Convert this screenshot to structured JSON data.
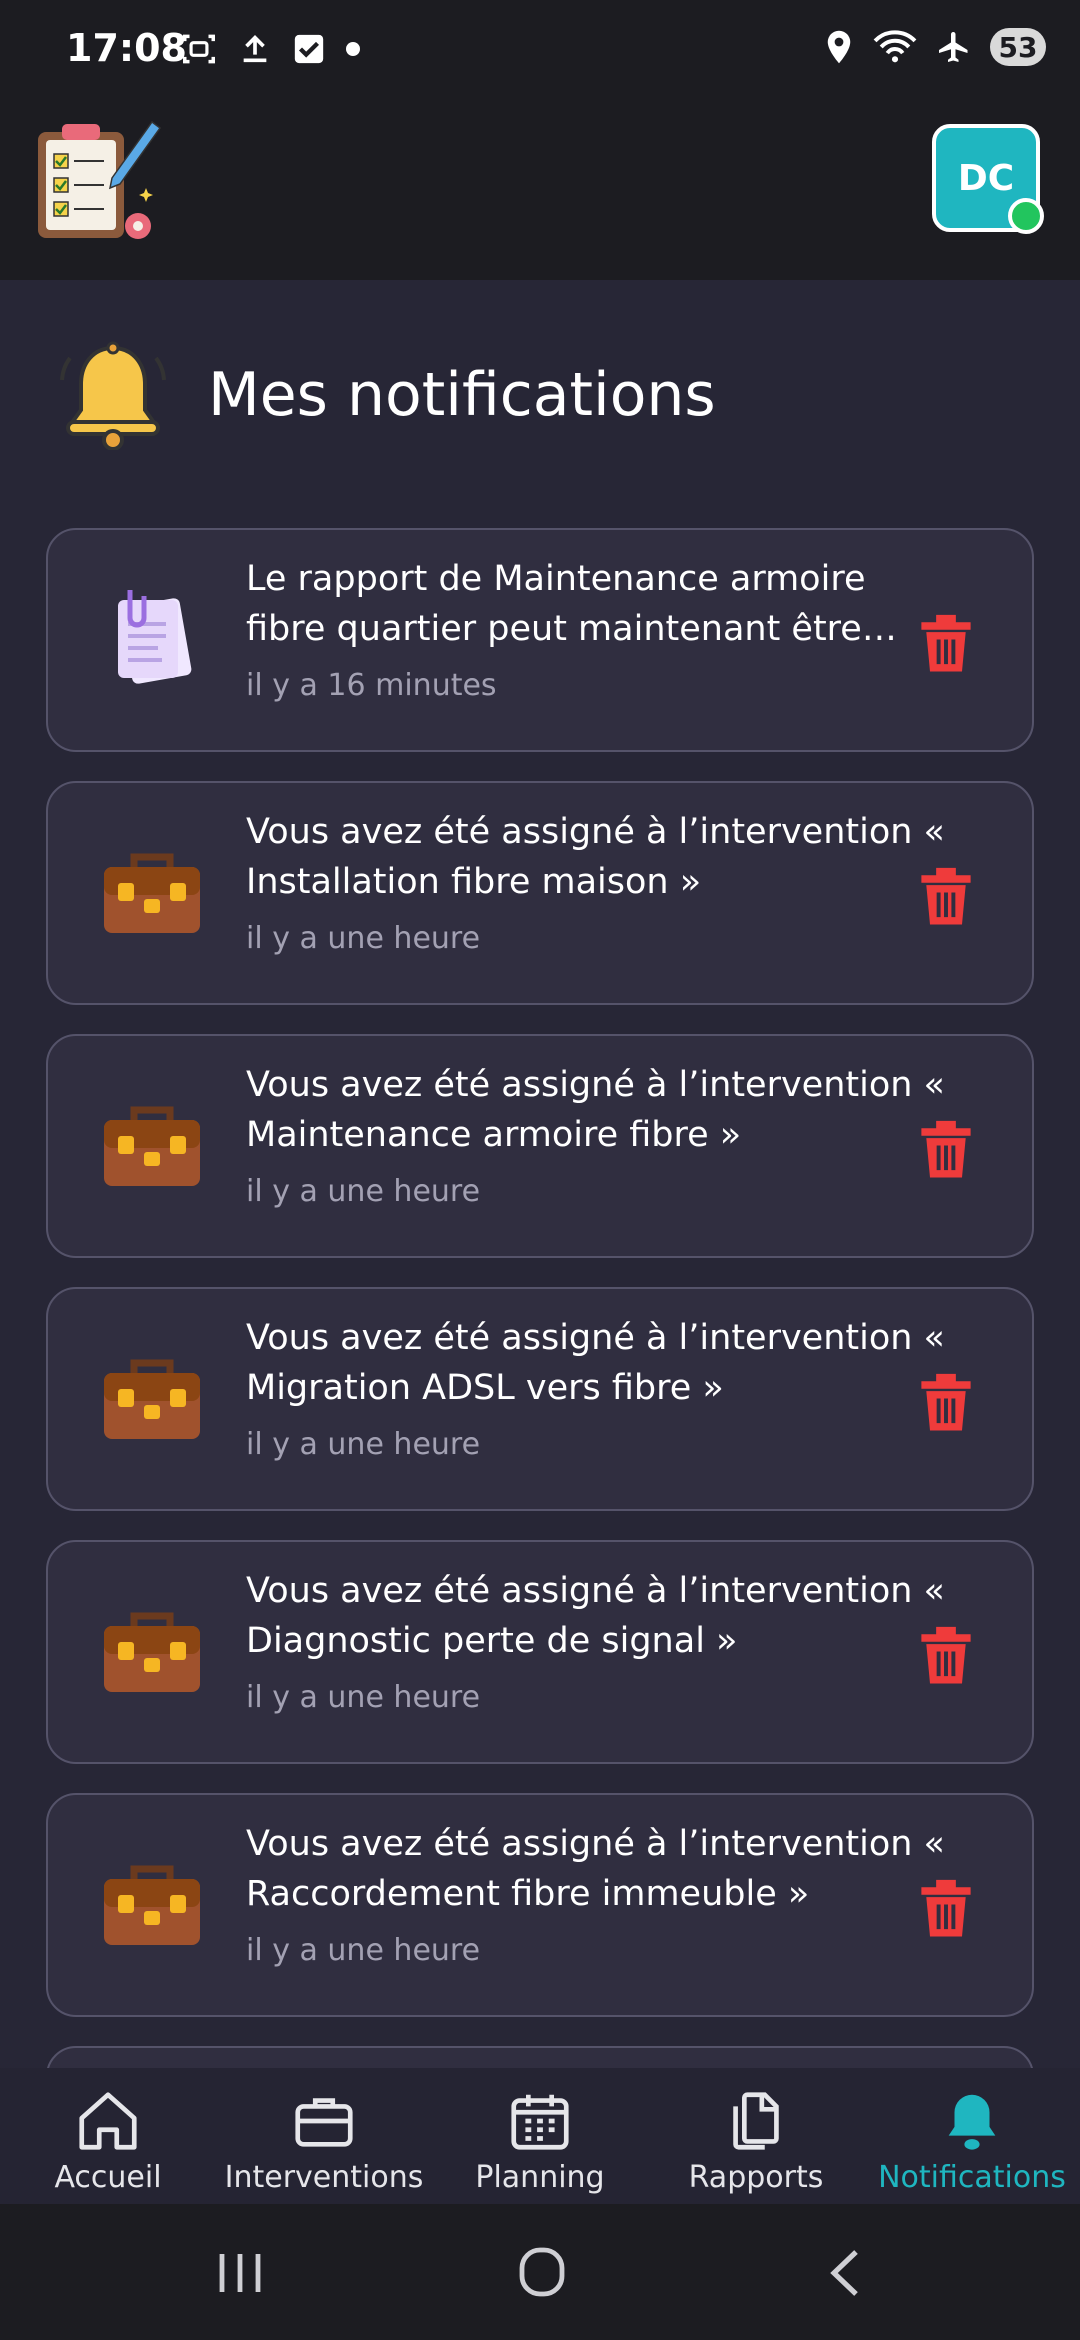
{
  "status_bar": {
    "time": "17:08",
    "battery": "53"
  },
  "header": {
    "avatar_initials": "DC"
  },
  "page": {
    "title": "Mes notifications"
  },
  "notifications": [
    {
      "icon": "document-icon",
      "message": "Le rapport de Maintenance armoire fibre quartier peut maintenant être consulté",
      "time": "il y a 16 minutes"
    },
    {
      "icon": "briefcase-icon",
      "message": "Vous avez été assigné à l’intervention « Installation fibre maison »",
      "time": "il y a une heure"
    },
    {
      "icon": "briefcase-icon",
      "message": "Vous avez été assigné à l’intervention « Maintenance armoire fibre »",
      "time": "il y a une heure"
    },
    {
      "icon": "briefcase-icon",
      "message": "Vous avez été assigné à l’intervention « Migration ADSL vers fibre »",
      "time": "il y a une heure"
    },
    {
      "icon": "briefcase-icon",
      "message": "Vous avez été assigné à l’intervention « Diagnostic perte de signal »",
      "time": "il y a une heure"
    },
    {
      "icon": "briefcase-icon",
      "message": "Vous avez été assigné à l’intervention « Raccordement fibre immeuble »",
      "time": "il y a une heure"
    }
  ],
  "bottom_nav": [
    {
      "label": "Accueil",
      "icon": "home-icon"
    },
    {
      "label": "Interventions",
      "icon": "briefcase-outline-icon"
    },
    {
      "label": "Planning",
      "icon": "calendar-icon"
    },
    {
      "label": "Rapports",
      "icon": "documents-icon"
    },
    {
      "label": "Notifications",
      "icon": "bell-icon",
      "active": true
    }
  ],
  "colors": {
    "accent": "#1fb6c0",
    "delete": "#ef3b3b",
    "background": "#272636",
    "card": "#302e40"
  }
}
